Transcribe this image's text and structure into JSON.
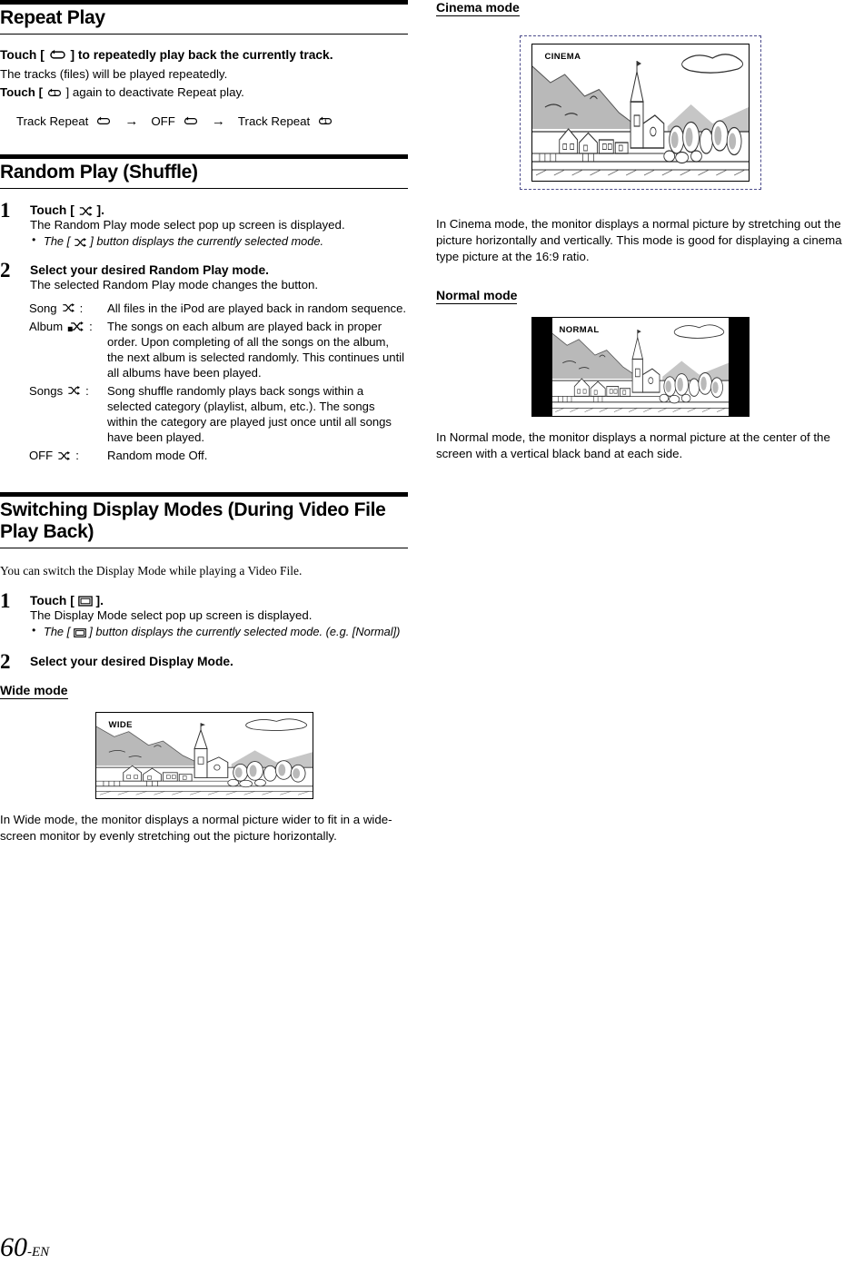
{
  "page": {
    "number": "60",
    "suffix": "-EN"
  },
  "left": {
    "section1": {
      "title": "Repeat Play",
      "lead": "Touch [ ] to repeatedly play back the currently track.",
      "lead_pre": "Touch [",
      "lead_post": "] to repeatedly play back the currently track.",
      "line1": "The tracks (files) will be played repeatedly.",
      "line2_pre": "Touch [",
      "line2_post": "] again to deactivate Repeat play.",
      "flow": {
        "item1": "Track Repeat",
        "arrow1": "→",
        "item2": "OFF",
        "arrow2": "→",
        "item3": "Track Repeat"
      }
    },
    "section2": {
      "title": "Random Play (Shuffle)",
      "step1": {
        "num": "1",
        "title_pre": "Touch [",
        "title_post": "].",
        "sub": "The Random Play mode select pop up screen is displayed.",
        "bullet_pre": "The [",
        "bullet_post": "] button displays the currently selected mode."
      },
      "step2": {
        "num": "2",
        "title": "Select your desired Random Play mode.",
        "sub": "The selected Random Play mode changes the button.",
        "rows": [
          {
            "key": "Song",
            "icon": "shuffle-song-icon",
            "colon": ":",
            "value": "All files in the iPod are played back in random sequence."
          },
          {
            "key": "Album",
            "icon": "shuffle-album-icon",
            "colon": ":",
            "value": "The songs on each album are played back in proper order. Upon completing of all the songs on the album, the next album is selected randomly. This continues until all albums have been played."
          },
          {
            "key": "Songs",
            "icon": "shuffle-songs-icon",
            "colon": ":",
            "value": "Song shuffle randomly plays back songs within a selected category (playlist, album, etc.). The songs within the category are played just once until all songs have been played."
          },
          {
            "key": "OFF",
            "icon": "shuffle-off-icon",
            "colon": ":",
            "value": "Random mode Off."
          }
        ]
      }
    },
    "section3": {
      "title": "Switching Display Modes (During Video File Play Back)",
      "intro": "You can switch the Display Mode while playing a Video File.",
      "step1": {
        "num": "1",
        "title_pre": "Touch [",
        "title_post": "].",
        "sub": "The Display Mode select pop up screen is displayed.",
        "bullet_pre": "The [",
        "bullet_post": "] button displays the currently selected mode. (e.g. [Normal])"
      },
      "step2": {
        "num": "2",
        "title": "Select your desired Display Mode."
      },
      "wide": {
        "head": "Wide mode",
        "screen_label": "WIDE",
        "caption": "In Wide mode, the monitor displays a normal picture wider to fit in a wide-screen monitor by evenly stretching out the picture horizontally."
      }
    }
  },
  "right": {
    "cinema": {
      "head": "Cinema mode",
      "screen_label": "CINEMA",
      "caption": "In Cinema mode, the monitor displays a normal picture by stretching out the picture horizontally and vertically. This mode is good for displaying a cinema type picture at the 16:9 ratio."
    },
    "normal": {
      "head": "Normal mode",
      "screen_label": "NORMAL",
      "caption": "In Normal mode, the monitor displays a normal picture at the center of the screen with a vertical black band at each side."
    }
  },
  "colors": {
    "ink": "#000000",
    "sky": "#b8b8b8",
    "dashed": "#4a4a8a"
  }
}
